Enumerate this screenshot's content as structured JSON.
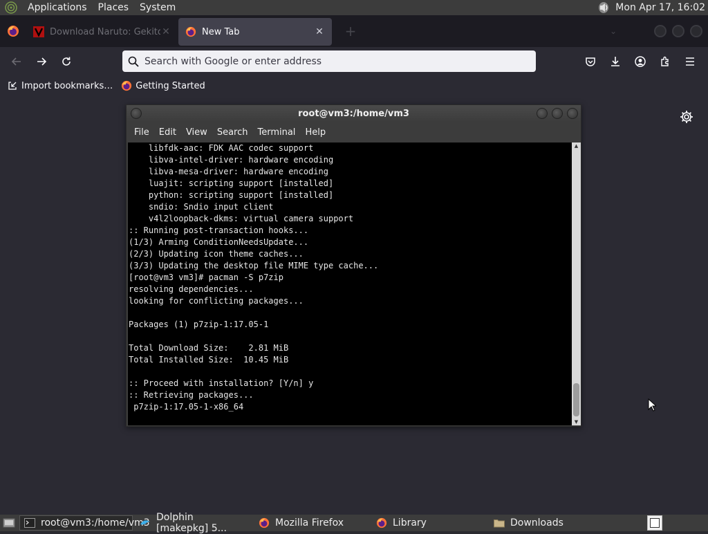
{
  "top_panel": {
    "menus": [
      "Applications",
      "Places",
      "System"
    ],
    "clock": "Mon Apr 17, 16:02"
  },
  "tabs": [
    {
      "title": "Download Naruto: Gekito...",
      "favicon": "naruto-favicon-icon",
      "active": false
    },
    {
      "title": "New Tab",
      "favicon": "firefox-icon",
      "active": true
    }
  ],
  "nav": {
    "search_placeholder": "Search with Google or enter address"
  },
  "bookmarks": [
    {
      "label": "Import bookmarks…",
      "icon": "import-icon"
    },
    {
      "label": "Getting Started",
      "icon": "firefox-icon"
    }
  ],
  "terminal": {
    "title": "root@vm3:/home/vm3",
    "menus": [
      "File",
      "Edit",
      "View",
      "Search",
      "Terminal",
      "Help"
    ],
    "lines": [
      "    libfdk-aac: FDK AAC codec support",
      "    libva-intel-driver: hardware encoding",
      "    libva-mesa-driver: hardware encoding",
      "    luajit: scripting support [installed]",
      "    python: scripting support [installed]",
      "    sndio: Sndio input client",
      "    v4l2loopback-dkms: virtual camera support",
      ":: Running post-transaction hooks...",
      "(1/3) Arming ConditionNeedsUpdate...",
      "(2/3) Updating icon theme caches...",
      "(3/3) Updating the desktop file MIME type cache...",
      "[root@vm3 vm3]# pacman -S p7zip",
      "resolving dependencies...",
      "looking for conflicting packages...",
      "",
      "Packages (1) p7zip-1:17.05-1",
      "",
      "Total Download Size:    2.81 MiB",
      "Total Installed Size:  10.45 MiB",
      "",
      ":: Proceed with installation? [Y/n] y",
      ":: Retrieving packages...",
      " p7zip-1:17.05-1-x86_64"
    ]
  },
  "taskbar": {
    "items": [
      {
        "label": "root@vm3:/home/vm3",
        "icon": "terminal-icon",
        "active": true
      },
      {
        "label": "Dolphin [makepkg] 5...",
        "icon": "dolphin-icon",
        "active": false
      },
      {
        "label": "Mozilla Firefox",
        "icon": "firefox-icon",
        "active": false
      },
      {
        "label": "Library",
        "icon": "firefox-icon",
        "active": false
      },
      {
        "label": "Downloads",
        "icon": "folder-icon",
        "active": false
      }
    ]
  },
  "colors": {
    "firefox_chrome": "#1c1b22",
    "toolbar": "#2b2a33",
    "active_tab": "#42414d",
    "terminal_bg": "#000000",
    "panel": "#3c3c3c"
  }
}
